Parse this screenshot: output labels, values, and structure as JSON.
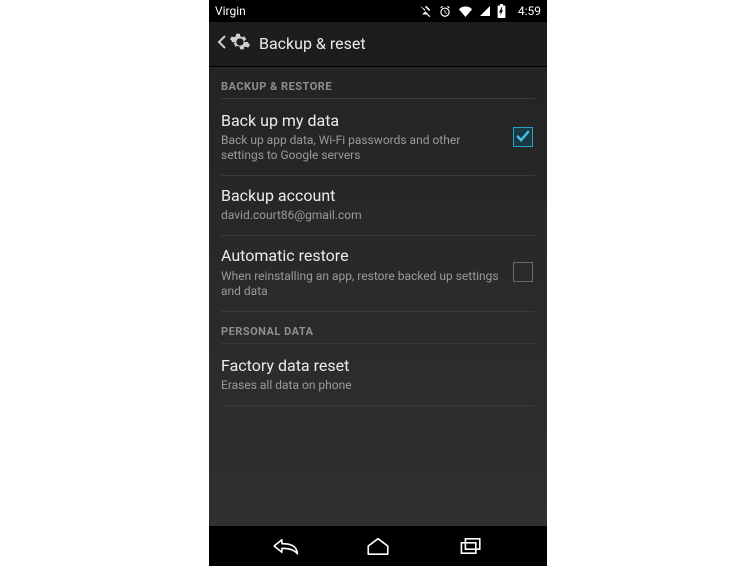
{
  "status": {
    "carrier": "Virgin",
    "time": "4:59",
    "icons": {
      "mute": "mute-icon",
      "alarm": "alarm-icon",
      "wifi": "wifi-icon",
      "signal": "signal-icon",
      "battery_charging": "battery-charging-icon"
    }
  },
  "actionbar": {
    "title": "Backup & reset",
    "back": "back-icon",
    "settings_gear": "gear-icon"
  },
  "sections": {
    "backup_restore": {
      "header": "BACKUP & RESTORE",
      "backup_my_data": {
        "title": "Back up my data",
        "sub": "Back up app data, Wi-Fi passwords and other settings to Google servers",
        "checked": true
      },
      "backup_account": {
        "title": "Backup account",
        "sub": "david.court86@gmail.com"
      },
      "automatic_restore": {
        "title": "Automatic restore",
        "sub": "When reinstalling an app, restore backed up settings and data",
        "checked": false
      }
    },
    "personal_data": {
      "header": "PERSONAL DATA",
      "factory_reset": {
        "title": "Factory data reset",
        "sub": "Erases all data on phone"
      }
    }
  },
  "navbar": {
    "back": "nav-back-icon",
    "home": "nav-home-icon",
    "recent": "nav-recent-icon"
  }
}
